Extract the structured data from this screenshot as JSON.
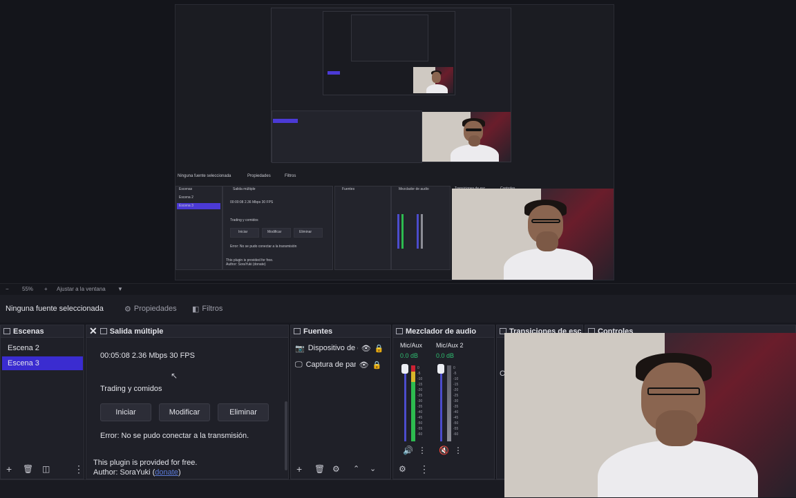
{
  "preview": {
    "zoom_value": "55%",
    "zoom_fit_label": "Ajustar a la ventana",
    "mini_text": {
      "stats": "00:00:08 2.36 Mbps 30 FPS",
      "trading": "Trading y comidos",
      "btn_start": "Iniciar",
      "btn_modify": "Modificar",
      "btn_delete": "Eliminar",
      "error": "Error: No se pudo conectar a la transmisión",
      "plugin": "This plugin is provided for free.",
      "author": "Author: SoraYuki (donate)",
      "scene2": "Escena 2",
      "scene3": "Escena 3",
      "no_source": "Ninguna fuente seleccionada",
      "props": "Propiedades",
      "filters": "Filtros",
      "scenes": "Escenas",
      "multi": "Salida múltiple",
      "sources": "Fuentes",
      "mixer": "Mezclador de audio",
      "transitions": "Transiciones de esc",
      "controls": "Controles"
    }
  },
  "source_toolbar": {
    "no_source": "Ninguna fuente seleccionada",
    "properties": "Propiedades",
    "filters": "Filtros"
  },
  "scenes": {
    "title": "Escenas",
    "items": [
      {
        "label": "Escena 2",
        "selected": false
      },
      {
        "label": "Escena 3",
        "selected": true
      }
    ]
  },
  "multi_output": {
    "title": "Salida múltiple",
    "stats": "00:05:08  2.36 Mbps  30 FPS",
    "target_name": "Trading y comidos",
    "start_label": "Iniciar",
    "modify_label": "Modificar",
    "delete_label": "Eliminar",
    "error": "Error: No se pudo conectar a la transmisión.",
    "plugin_note": "This plugin is provided for free.",
    "author_prefix": "Author: SoraYuki (",
    "donate_link": "donate",
    "author_suffix": ")"
  },
  "sources": {
    "title": "Fuentes",
    "items": [
      {
        "label": "Dispositivo de c",
        "icon": "camera-icon"
      },
      {
        "label": "Captura de pan",
        "icon": "monitor-icon"
      }
    ]
  },
  "mixer": {
    "title": "Mezclador de audio",
    "channels": [
      {
        "name": "Mic/Aux",
        "db": "0.0 dB"
      },
      {
        "name": "Mic/Aux 2",
        "db": "0.0 dB"
      }
    ]
  },
  "transitions": {
    "title": "Transiciones de esc"
  },
  "controls": {
    "title": "Controles",
    "partial": "C"
  },
  "colors": {
    "accent": "#3a2cd0",
    "background": "#17181f",
    "meter_green": "#2dbb4f",
    "meter_yellow": "#d8b52a",
    "meter_red": "#cc2233"
  }
}
